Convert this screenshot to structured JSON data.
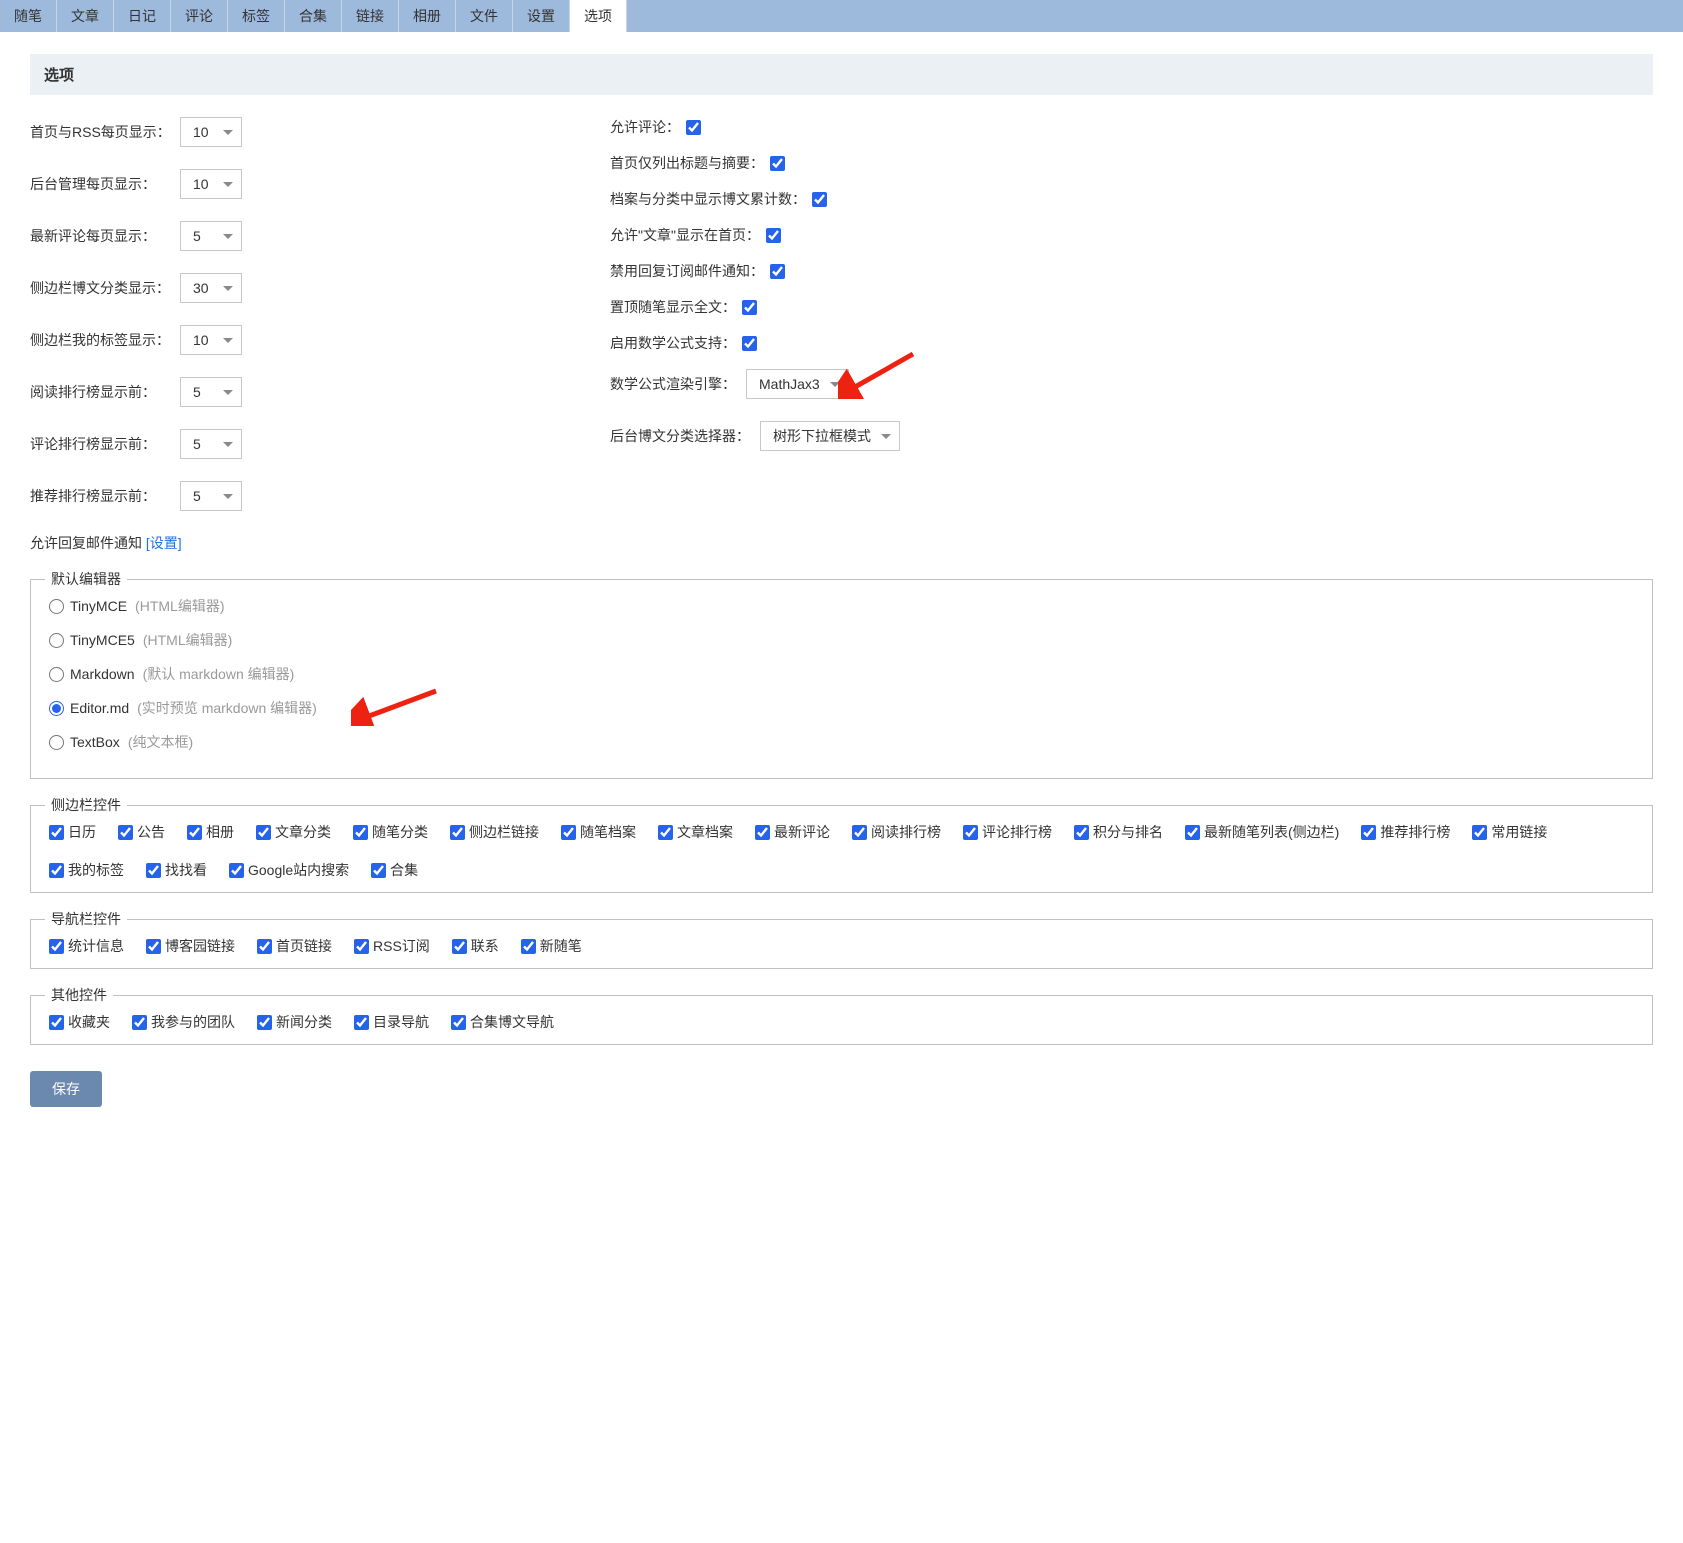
{
  "tabs": [
    "随笔",
    "文章",
    "日记",
    "评论",
    "标签",
    "合集",
    "链接",
    "相册",
    "文件",
    "设置",
    "选项"
  ],
  "activeTab": "选项",
  "pageTitle": "选项",
  "left": {
    "homeRss": {
      "label": "首页与RSS每页显示：",
      "value": "10"
    },
    "adminPerPage": {
      "label": "后台管理每页显示：",
      "value": "10"
    },
    "commentPerPage": {
      "label": "最新评论每页显示：",
      "value": "5"
    },
    "sidebarCategory": {
      "label": "侧边栏博文分类显示：",
      "value": "30"
    },
    "sidebarTags": {
      "label": "侧边栏我的标签显示：",
      "value": "10"
    },
    "readRank": {
      "label": "阅读排行榜显示前：",
      "value": "5"
    },
    "commentRank": {
      "label": "评论排行榜显示前：",
      "value": "5"
    },
    "recommendRank": {
      "label": "推荐排行榜显示前：",
      "value": "5"
    },
    "mailNotice": {
      "label": "允许回复邮件通知",
      "link": "[设置]"
    }
  },
  "right": {
    "allowComment": {
      "label": "允许评论：",
      "checked": true
    },
    "titleSummary": {
      "label": "首页仅列出标题与摘要：",
      "checked": true
    },
    "archiveCount": {
      "label": "档案与分类中显示博文累计数：",
      "checked": true
    },
    "allowArticle": {
      "label": "允许\"文章\"显示在首页：",
      "checked": true
    },
    "disableReplyMail": {
      "label": "禁用回复订阅邮件通知：",
      "checked": true
    },
    "pinFullText": {
      "label": "置顶随笔显示全文：",
      "checked": true
    },
    "enableMath": {
      "label": "启用数学公式支持：",
      "checked": true
    },
    "mathEngine": {
      "label": "数学公式渲染引擎：",
      "value": "MathJax3"
    },
    "categorySelector": {
      "label": "后台博文分类选择器：",
      "value": "树形下拉框模式"
    }
  },
  "editor": {
    "legend": "默认编辑器",
    "options": [
      {
        "name": "TinyMCE",
        "desc": "(HTML编辑器)",
        "checked": false
      },
      {
        "name": "TinyMCE5",
        "desc": "(HTML编辑器)",
        "checked": false
      },
      {
        "name": "Markdown",
        "desc": "(默认 markdown 编辑器)",
        "checked": false
      },
      {
        "name": "Editor.md",
        "desc": "(实时预览 markdown 编辑器)",
        "checked": true
      },
      {
        "name": "TextBox",
        "desc": "(纯文本框)",
        "checked": false
      }
    ]
  },
  "sidebarWidgets": {
    "legend": "侧边栏控件",
    "items": [
      "日历",
      "公告",
      "相册",
      "文章分类",
      "随笔分类",
      "侧边栏链接",
      "随笔档案",
      "文章档案",
      "最新评论",
      "阅读排行榜",
      "评论排行榜",
      "积分与排名",
      "最新随笔列表(侧边栏)",
      "推荐排行榜",
      "常用链接",
      "我的标签",
      "找找看",
      "Google站内搜索",
      "合集"
    ]
  },
  "navWidgets": {
    "legend": "导航栏控件",
    "items": [
      "统计信息",
      "博客园链接",
      "首页链接",
      "RSS订阅",
      "联系",
      "新随笔"
    ]
  },
  "otherWidgets": {
    "legend": "其他控件",
    "items": [
      "收藏夹",
      "我参与的团队",
      "新闻分类",
      "目录导航",
      "合集博文导航"
    ]
  },
  "saveButton": "保存"
}
